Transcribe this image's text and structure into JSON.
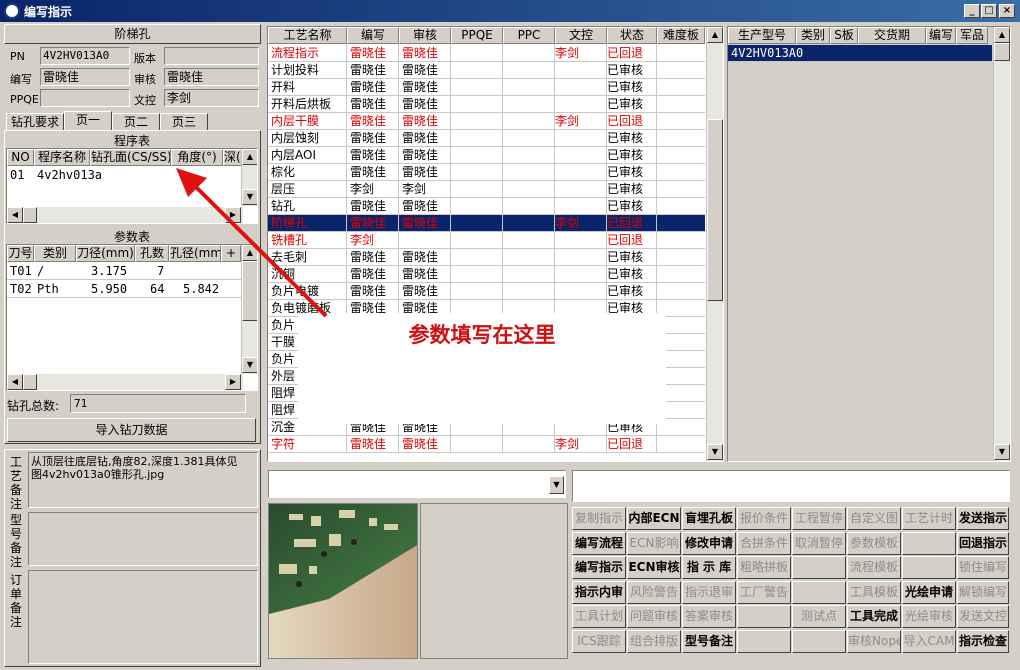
{
  "window": {
    "title": "编写指示",
    "min": "_",
    "max": "□",
    "close": "×"
  },
  "left": {
    "header": "阶梯孔",
    "pn_label": "PN",
    "pn_value": "4V2HV013A0",
    "version_label": "版本",
    "version_value": "",
    "write_label": "编写",
    "write_value": "雷晓佳",
    "review_label": "审核",
    "review_value": "雷晓佳",
    "ppqe_label": "PPQE",
    "ppqe_value": "",
    "doc_label": "文控",
    "doc_value": "李剑",
    "tabs": [
      "钻孔要求",
      "页一",
      "页二",
      "页三"
    ],
    "program_title": "程序表",
    "program_cols": [
      "NO",
      "程序名称",
      "钻孔面(CS/SS)",
      "角度(°)",
      "深(mm)"
    ],
    "program_rows": [
      [
        "01",
        "4v2hv013a",
        "",
        "",
        ""
      ]
    ],
    "param_title": "参数表",
    "param_cols": [
      "刀号",
      "类别",
      "刀径(mm)",
      "孔数",
      "孔径(mm)",
      "+"
    ],
    "param_rows": [
      [
        "T01",
        "/",
        "3.175",
        "7",
        ""
      ],
      [
        "T02",
        "Pth",
        "5.950",
        "64",
        "5.842"
      ]
    ],
    "total_label": "钻孔总数:",
    "total_value": "71",
    "import_btn": "导入钻刀数据",
    "craft_note_label": "工艺备注",
    "craft_note": "从顶层往底层钻,角度82,深度1.381具体见图4v2hv013a0锥形孔.jpg",
    "model_note_label": "型号备注",
    "model_note": "",
    "order_note_label": "订单备注",
    "order_note": ""
  },
  "process": {
    "cols": [
      "工艺名称",
      "编写",
      "审核",
      "PPQE",
      "PPC",
      "文控",
      "状态",
      "难度板"
    ],
    "rows": [
      {
        "name": "流程指示",
        "write": "雷晓佳",
        "review": "雷晓佳",
        "doc": "李剑",
        "status": "已回退",
        "style": "red"
      },
      {
        "name": "计划投料",
        "write": "雷晓佳",
        "review": "雷晓佳",
        "doc": "",
        "status": "已审核",
        "style": ""
      },
      {
        "name": "开料",
        "write": "雷晓佳",
        "review": "雷晓佳",
        "doc": "",
        "status": "已审核",
        "style": ""
      },
      {
        "name": "开料后烘板",
        "write": "雷晓佳",
        "review": "雷晓佳",
        "doc": "",
        "status": "已审核",
        "style": ""
      },
      {
        "name": "内层干膜",
        "write": "雷晓佳",
        "review": "雷晓佳",
        "doc": "李剑",
        "status": "已回退",
        "style": "red"
      },
      {
        "name": "内层蚀刻",
        "write": "雷晓佳",
        "review": "雷晓佳",
        "doc": "",
        "status": "已审核",
        "style": ""
      },
      {
        "name": "内层AOI",
        "write": "雷晓佳",
        "review": "雷晓佳",
        "doc": "",
        "status": "已审核",
        "style": ""
      },
      {
        "name": "棕化",
        "write": "雷晓佳",
        "review": "雷晓佳",
        "doc": "",
        "status": "已审核",
        "style": ""
      },
      {
        "name": "层压",
        "write": "李剑",
        "review": "李剑",
        "doc": "",
        "status": "已审核",
        "style": ""
      },
      {
        "name": "钻孔",
        "write": "雷晓佳",
        "review": "雷晓佳",
        "doc": "",
        "status": "已审核",
        "style": ""
      },
      {
        "name": "阶梯孔",
        "write": "雷晓佳",
        "review": "雷晓佳",
        "doc": "李剑",
        "status": "已回退",
        "style": "sel"
      },
      {
        "name": "铣槽孔",
        "write": "李剑",
        "review": "",
        "doc": "",
        "status": "已回退",
        "style": "red"
      },
      {
        "name": "去毛刺",
        "write": "雷晓佳",
        "review": "雷晓佳",
        "doc": "",
        "status": "已审核",
        "style": ""
      },
      {
        "name": "沉铜",
        "write": "雷晓佳",
        "review": "雷晓佳",
        "doc": "",
        "status": "已审核",
        "style": ""
      },
      {
        "name": "负片电镀",
        "write": "雷晓佳",
        "review": "雷晓佳",
        "doc": "",
        "status": "已审核",
        "style": ""
      },
      {
        "name": "负电镀磨板",
        "write": "雷晓佳",
        "review": "雷晓佳",
        "doc": "",
        "status": "已审核",
        "style": ""
      },
      {
        "name": "负片",
        "write": "",
        "review": "",
        "doc": "",
        "status": "",
        "style": ""
      },
      {
        "name": "干膜",
        "write": "",
        "review": "",
        "doc": "",
        "status": "",
        "style": ""
      },
      {
        "name": "负片",
        "write": "",
        "review": "",
        "doc": "",
        "status": "",
        "style": ""
      },
      {
        "name": "外层",
        "write": "",
        "review": "",
        "doc": "",
        "status": "",
        "style": ""
      },
      {
        "name": "阻焊",
        "write": "",
        "review": "",
        "doc": "",
        "status": "",
        "style": ""
      },
      {
        "name": "阻焊",
        "write": "",
        "review": "",
        "doc": "",
        "status": "",
        "style": ""
      },
      {
        "name": "沉金",
        "write": "雷晓佳",
        "review": "雷晓佳",
        "doc": "",
        "status": "已审核",
        "style": ""
      },
      {
        "name": "字符",
        "write": "雷晓佳",
        "review": "雷晓佳",
        "doc": "李剑",
        "status": "已回退",
        "style": "red"
      }
    ]
  },
  "product": {
    "cols": [
      "生产型号",
      "类别",
      "S板",
      "交货期",
      "编写",
      "军品"
    ],
    "rows": [
      [
        "4V2HV013A0",
        "",
        "",
        "",
        "",
        ""
      ]
    ]
  },
  "annotation": {
    "text": "参数填写在这里"
  },
  "buttons": [
    [
      "复制指示",
      "内部ECN",
      "盲埋孔板",
      "报价条件",
      "工程暂停",
      "自定义图",
      "工艺计时",
      "发送指示"
    ],
    [
      "编写流程",
      "ECN影响",
      "修改申请",
      "合拼条件",
      "取消暂停",
      "参数模板",
      "",
      "回退指示"
    ],
    [
      "编写指示",
      "ECN审核",
      "指 示 库",
      "粗略拼板",
      "",
      "流程模板",
      "",
      "锁住编写"
    ],
    [
      "指示内审",
      "风险警告",
      "指示退审",
      "工厂警告",
      "",
      "工具模板",
      "光绘申请",
      "解锁编写"
    ],
    [
      "工具计划",
      "问题审核",
      "答案审核",
      "",
      "测试点",
      "工具完成",
      "光绘审核",
      "发送文控"
    ],
    [
      "ICS跟踪",
      "组合排版",
      "型号备注",
      "",
      "",
      "审核Nope",
      "导入CAM",
      "指示检查"
    ]
  ],
  "buttons_enabled": [
    [
      0,
      1,
      1,
      0,
      0,
      0,
      0,
      1
    ],
    [
      1,
      0,
      1,
      0,
      0,
      0,
      0,
      1
    ],
    [
      1,
      1,
      1,
      0,
      0,
      0,
      0,
      0
    ],
    [
      1,
      0,
      0,
      0,
      0,
      0,
      1,
      0
    ],
    [
      0,
      0,
      0,
      0,
      0,
      1,
      0,
      0
    ],
    [
      0,
      0,
      1,
      0,
      0,
      0,
      0,
      1
    ]
  ]
}
